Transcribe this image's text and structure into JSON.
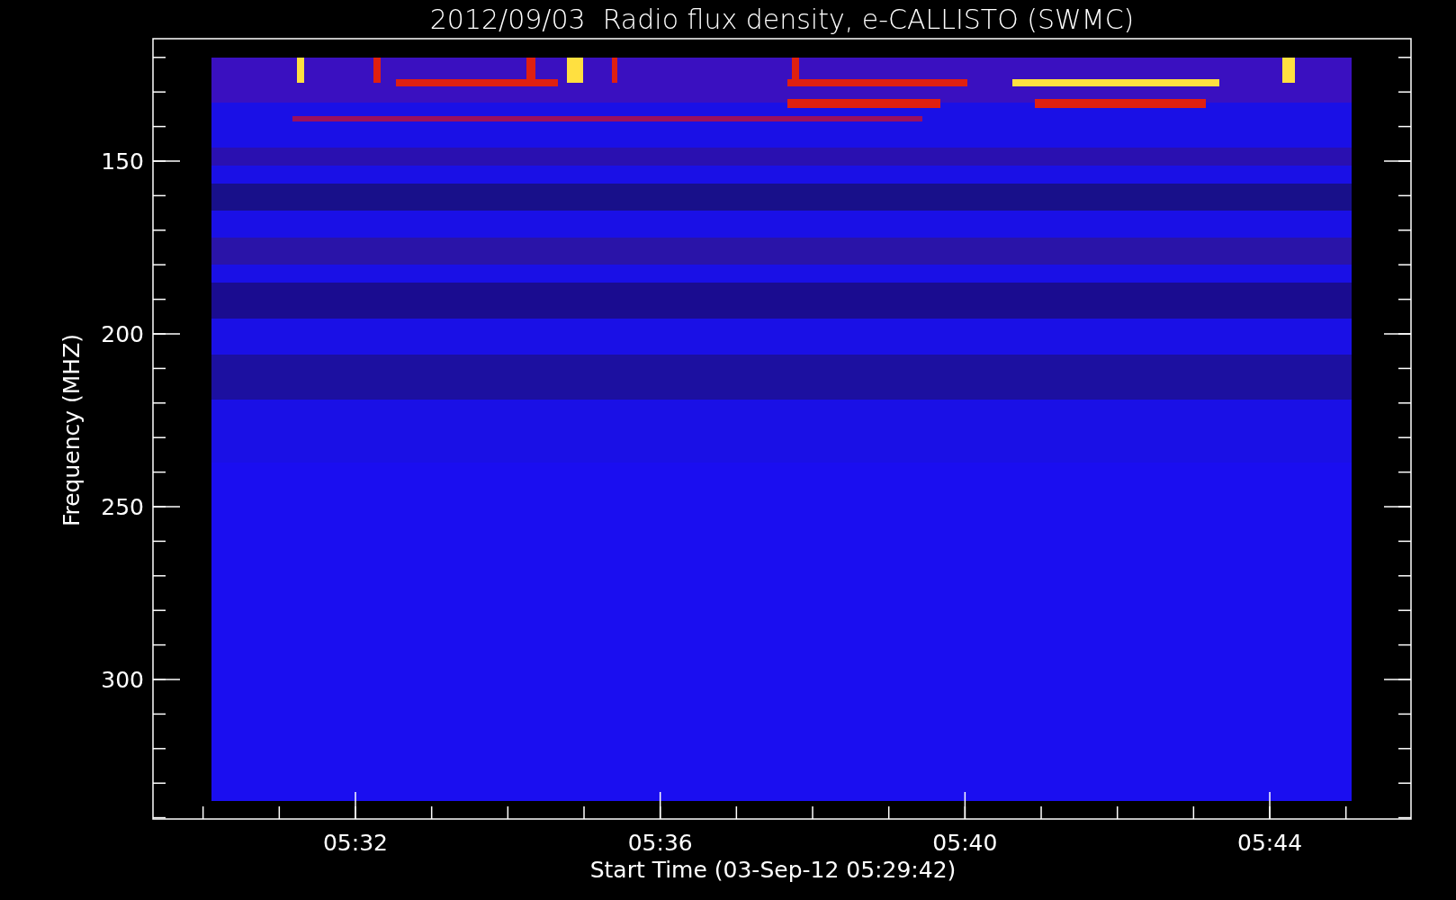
{
  "title": "2012/09/03  Radio flux density, e-CALLISTO (SWMC)",
  "y_axis": {
    "label": "Frequency (MHZ)",
    "ticks": [
      "150",
      "200",
      "250",
      "300"
    ]
  },
  "x_axis": {
    "label": "Start Time (03-Sep-12 05:29:42)",
    "ticks": [
      "05:32",
      "05:36",
      "05:40",
      "05:44"
    ]
  }
}
